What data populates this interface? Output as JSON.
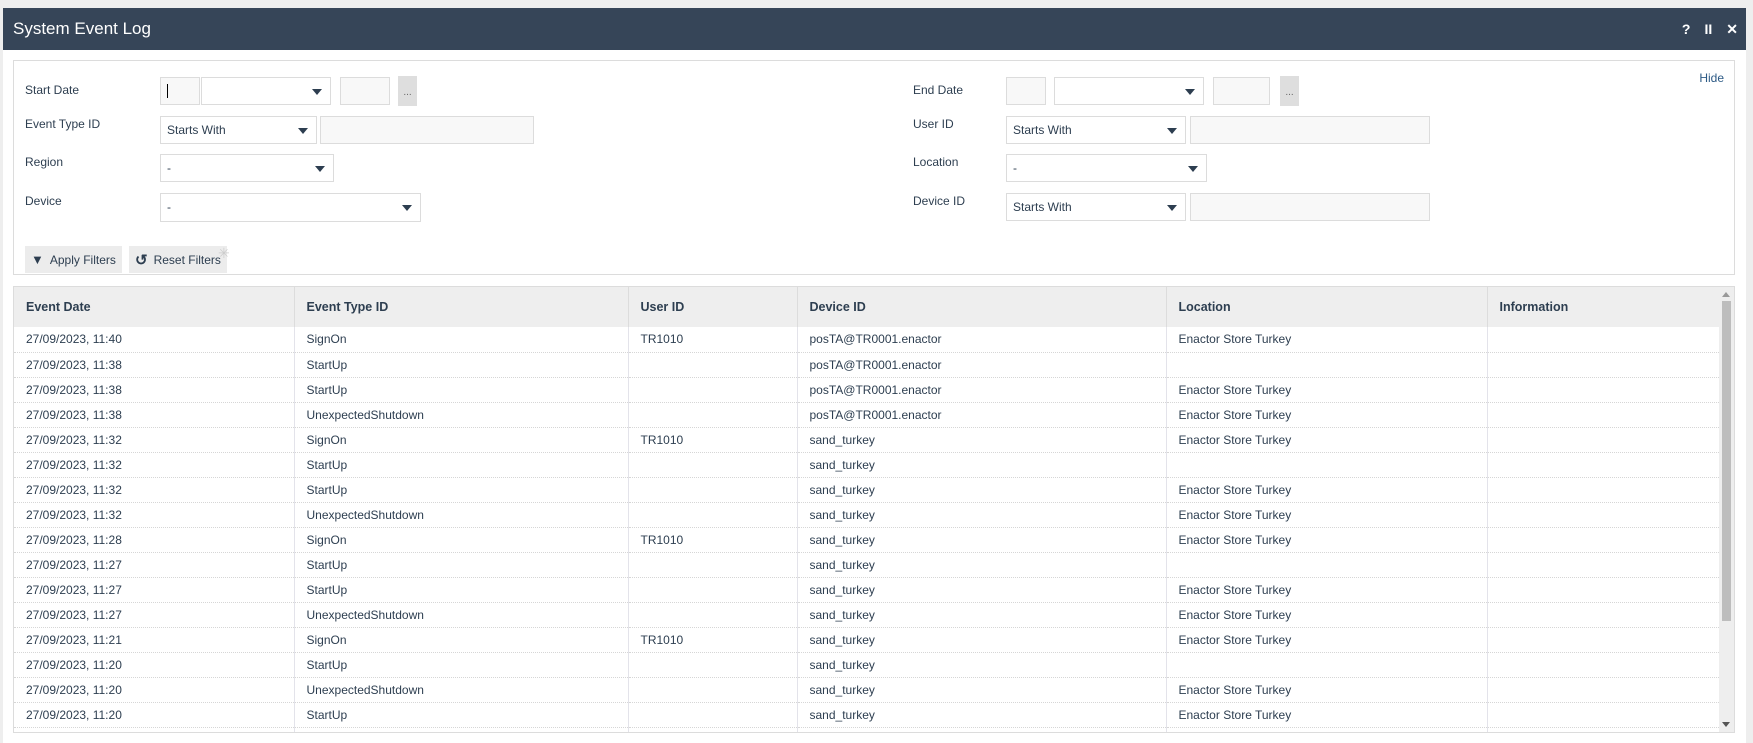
{
  "window": {
    "title": "System Event Log",
    "icons": [
      "help-icon",
      "pause-icon",
      "close-icon"
    ],
    "help": "?",
    "pause": "II",
    "close": "✕"
  },
  "filters": {
    "hide": "Hide",
    "start_date": {
      "label": "Start Date",
      "value": "",
      "month": "",
      "year": "",
      "picker": "..."
    },
    "end_date": {
      "label": "End Date",
      "value": "",
      "month": "",
      "year": "",
      "picker": "..."
    },
    "event_type": {
      "label": "Event Type ID",
      "mode": "Starts With",
      "value": ""
    },
    "user_id": {
      "label": "User ID",
      "mode": "Starts With",
      "value": ""
    },
    "region": {
      "label": "Region",
      "value": "-"
    },
    "location": {
      "label": "Location",
      "value": "-"
    },
    "device": {
      "label": "Device",
      "value": "-"
    },
    "device_id": {
      "label": "Device ID",
      "mode": "Starts With",
      "value": ""
    },
    "apply": "Apply Filters",
    "reset": "Reset Filters"
  },
  "table": {
    "columns": [
      "Event Date",
      "Event Type ID",
      "User ID",
      "Device ID",
      "Location",
      "Information"
    ],
    "rows": [
      [
        "27/09/2023, 11:40",
        "SignOn",
        "TR1010",
        "posTA@TR0001.enactor",
        "Enactor Store Turkey",
        ""
      ],
      [
        "27/09/2023, 11:38",
        "StartUp",
        "",
        "posTA@TR0001.enactor",
        "",
        ""
      ],
      [
        "27/09/2023, 11:38",
        "StartUp",
        "",
        "posTA@TR0001.enactor",
        "Enactor Store Turkey",
        ""
      ],
      [
        "27/09/2023, 11:38",
        "UnexpectedShutdown",
        "",
        "posTA@TR0001.enactor",
        "Enactor Store Turkey",
        ""
      ],
      [
        "27/09/2023, 11:32",
        "SignOn",
        "TR1010",
        "sand_turkey",
        "Enactor Store Turkey",
        ""
      ],
      [
        "27/09/2023, 11:32",
        "StartUp",
        "",
        "sand_turkey",
        "",
        ""
      ],
      [
        "27/09/2023, 11:32",
        "StartUp",
        "",
        "sand_turkey",
        "Enactor Store Turkey",
        ""
      ],
      [
        "27/09/2023, 11:32",
        "UnexpectedShutdown",
        "",
        "sand_turkey",
        "Enactor Store Turkey",
        ""
      ],
      [
        "27/09/2023, 11:28",
        "SignOn",
        "TR1010",
        "sand_turkey",
        "Enactor Store Turkey",
        ""
      ],
      [
        "27/09/2023, 11:27",
        "StartUp",
        "",
        "sand_turkey",
        "",
        ""
      ],
      [
        "27/09/2023, 11:27",
        "StartUp",
        "",
        "sand_turkey",
        "Enactor Store Turkey",
        ""
      ],
      [
        "27/09/2023, 11:27",
        "UnexpectedShutdown",
        "",
        "sand_turkey",
        "Enactor Store Turkey",
        ""
      ],
      [
        "27/09/2023, 11:21",
        "SignOn",
        "TR1010",
        "sand_turkey",
        "Enactor Store Turkey",
        ""
      ],
      [
        "27/09/2023, 11:20",
        "StartUp",
        "",
        "sand_turkey",
        "",
        ""
      ],
      [
        "27/09/2023, 11:20",
        "UnexpectedShutdown",
        "",
        "sand_turkey",
        "Enactor Store Turkey",
        ""
      ],
      [
        "27/09/2023, 11:20",
        "StartUp",
        "",
        "sand_turkey",
        "Enactor Store Turkey",
        ""
      ],
      [
        "",
        "",
        "",
        "",
        "",
        ""
      ]
    ]
  }
}
